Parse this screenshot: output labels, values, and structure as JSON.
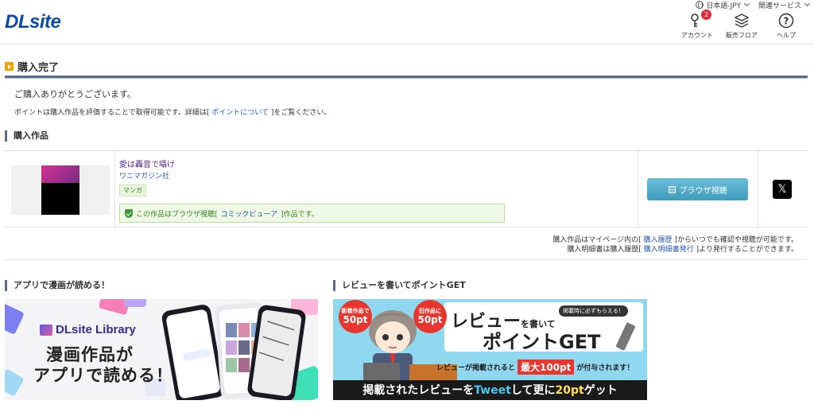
{
  "header": {
    "logo": "DLsite",
    "language": "日本語-JPY",
    "related": "関連サービス",
    "account_label": "アカウント",
    "account_badge": "2",
    "store_label": "販売フロア",
    "help_label": "ヘルプ"
  },
  "main": {
    "title": "購入完了",
    "thanks": "ご購入ありがとうございます。",
    "points_pre": "ポイントは購入作品を評価することで取得可能です。詳細は[ ",
    "points_link": "ポイントについて",
    "points_post": " ]をご覧ください。"
  },
  "works": {
    "title": "購入作品",
    "items": [
      {
        "name": "愛は轟音で囁け",
        "maker": "ワニマガジン社",
        "genre": "マンガ",
        "notice_pre": "この作品はブラウザ視聴[ ",
        "notice_link": "コミックビューア",
        "notice_post": " ]作品です。",
        "browse_label": "ブラウザ視聴",
        "share_label": "𝕏"
      }
    ],
    "note1_pre": "購入作品はマイページ内の[ ",
    "note1_link": "購入履歴",
    "note1_post": " ]からいつでも確認や視聴が可能です。",
    "note2_pre": "購入明細書は購入履歴[ ",
    "note2_link": "購入明細書発行",
    "note2_post": " ]より発行することができます。"
  },
  "banners": {
    "app": {
      "title": "アプリで漫画が読める！",
      "brand": "DLsite Library",
      "line1": "漫画作品が",
      "line2": "アプリで読める！"
    },
    "review": {
      "title": "レビューを書いてポイントGET",
      "badge1_top": "新着作品で",
      "badge1_value": "50pt",
      "badge2_top": "旧作品に",
      "badge2_value": "50pt",
      "every": "掲載時に必ずもらえる！",
      "headline1": "レビュー",
      "headline_small": "を書いて",
      "headline2": "ポイントGET",
      "sub_pre": "レビューが掲載されると",
      "sub_max": "最大100pt",
      "sub_post": "が付与されます！",
      "bottom_pre": "掲載されたレビューを",
      "bottom_tweet": "Tweet",
      "bottom_mid": "して更に",
      "bottom_pt": "20pt",
      "bottom_post": "ゲット"
    }
  }
}
